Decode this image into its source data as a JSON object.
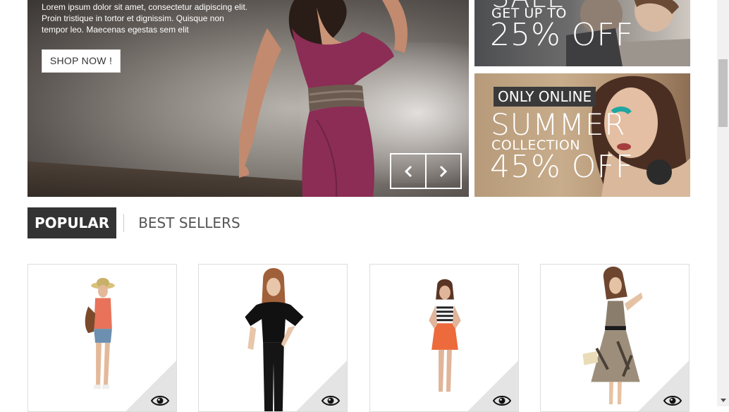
{
  "hero": {
    "description_line1": "Lorem ipsum dolor sit amet, consectetur adipiscing elit.",
    "description_line2": "Proin tristique in tortor et dignissim. Quisque non",
    "description_line3": "tempor leo. Maecenas egestas sem elit",
    "cta_label": "SHOP NOW !",
    "prev_icon": "chevron-left-icon",
    "next_icon": "chevron-right-icon"
  },
  "banners": {
    "sale": {
      "word": "SALE",
      "subline": "GET UP TO",
      "discount": "25% OFF"
    },
    "summer": {
      "badge": "ONLY ONLINE",
      "headline": "SUMMER",
      "subline": "COLLECTION",
      "discount": "45% OFF"
    }
  },
  "tabs": [
    {
      "label": "POPULAR",
      "active": true
    },
    {
      "label": "BEST SELLERS",
      "active": false
    }
  ],
  "products": [
    {
      "name": "product-1",
      "outfit": "orange top, denim shorts, straw hat",
      "quick_view_icon": "eye-icon"
    },
    {
      "name": "product-2",
      "outfit": "black ruffle blouse, black pants",
      "quick_view_icon": "eye-icon"
    },
    {
      "name": "product-3",
      "outfit": "striped top, orange skirt",
      "quick_view_icon": "eye-icon"
    },
    {
      "name": "product-4",
      "outfit": "patterned dress",
      "quick_view_icon": "eye-icon"
    }
  ],
  "colors": {
    "tab_active_bg": "#333333",
    "hero_dress": "#8b2d55",
    "summer_banner": "#c8ad8c"
  }
}
